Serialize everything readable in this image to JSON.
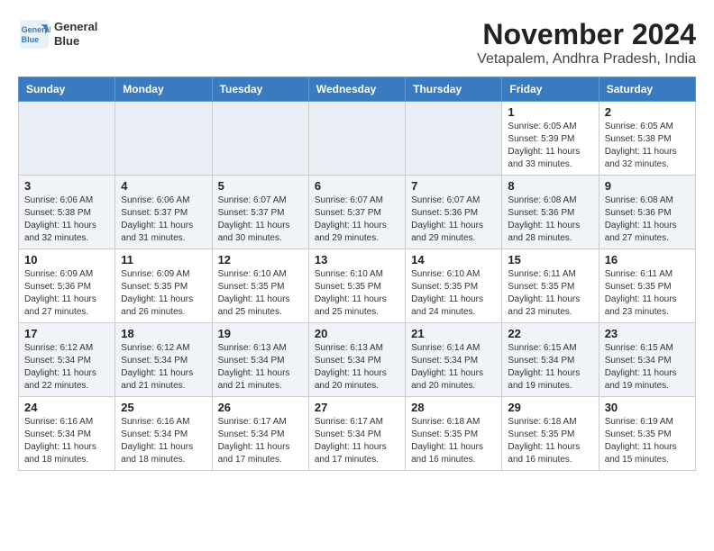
{
  "logo": {
    "line1": "General",
    "line2": "Blue"
  },
  "title": "November 2024",
  "subtitle": "Vetapalem, Andhra Pradesh, India",
  "weekdays": [
    "Sunday",
    "Monday",
    "Tuesday",
    "Wednesday",
    "Thursday",
    "Friday",
    "Saturday"
  ],
  "weeks": [
    [
      {
        "day": "",
        "info": ""
      },
      {
        "day": "",
        "info": ""
      },
      {
        "day": "",
        "info": ""
      },
      {
        "day": "",
        "info": ""
      },
      {
        "day": "",
        "info": ""
      },
      {
        "day": "1",
        "info": "Sunrise: 6:05 AM\nSunset: 5:39 PM\nDaylight: 11 hours\nand 33 minutes."
      },
      {
        "day": "2",
        "info": "Sunrise: 6:05 AM\nSunset: 5:38 PM\nDaylight: 11 hours\nand 32 minutes."
      }
    ],
    [
      {
        "day": "3",
        "info": "Sunrise: 6:06 AM\nSunset: 5:38 PM\nDaylight: 11 hours\nand 32 minutes."
      },
      {
        "day": "4",
        "info": "Sunrise: 6:06 AM\nSunset: 5:37 PM\nDaylight: 11 hours\nand 31 minutes."
      },
      {
        "day": "5",
        "info": "Sunrise: 6:07 AM\nSunset: 5:37 PM\nDaylight: 11 hours\nand 30 minutes."
      },
      {
        "day": "6",
        "info": "Sunrise: 6:07 AM\nSunset: 5:37 PM\nDaylight: 11 hours\nand 29 minutes."
      },
      {
        "day": "7",
        "info": "Sunrise: 6:07 AM\nSunset: 5:36 PM\nDaylight: 11 hours\nand 29 minutes."
      },
      {
        "day": "8",
        "info": "Sunrise: 6:08 AM\nSunset: 5:36 PM\nDaylight: 11 hours\nand 28 minutes."
      },
      {
        "day": "9",
        "info": "Sunrise: 6:08 AM\nSunset: 5:36 PM\nDaylight: 11 hours\nand 27 minutes."
      }
    ],
    [
      {
        "day": "10",
        "info": "Sunrise: 6:09 AM\nSunset: 5:36 PM\nDaylight: 11 hours\nand 27 minutes."
      },
      {
        "day": "11",
        "info": "Sunrise: 6:09 AM\nSunset: 5:35 PM\nDaylight: 11 hours\nand 26 minutes."
      },
      {
        "day": "12",
        "info": "Sunrise: 6:10 AM\nSunset: 5:35 PM\nDaylight: 11 hours\nand 25 minutes."
      },
      {
        "day": "13",
        "info": "Sunrise: 6:10 AM\nSunset: 5:35 PM\nDaylight: 11 hours\nand 25 minutes."
      },
      {
        "day": "14",
        "info": "Sunrise: 6:10 AM\nSunset: 5:35 PM\nDaylight: 11 hours\nand 24 minutes."
      },
      {
        "day": "15",
        "info": "Sunrise: 6:11 AM\nSunset: 5:35 PM\nDaylight: 11 hours\nand 23 minutes."
      },
      {
        "day": "16",
        "info": "Sunrise: 6:11 AM\nSunset: 5:35 PM\nDaylight: 11 hours\nand 23 minutes."
      }
    ],
    [
      {
        "day": "17",
        "info": "Sunrise: 6:12 AM\nSunset: 5:34 PM\nDaylight: 11 hours\nand 22 minutes."
      },
      {
        "day": "18",
        "info": "Sunrise: 6:12 AM\nSunset: 5:34 PM\nDaylight: 11 hours\nand 21 minutes."
      },
      {
        "day": "19",
        "info": "Sunrise: 6:13 AM\nSunset: 5:34 PM\nDaylight: 11 hours\nand 21 minutes."
      },
      {
        "day": "20",
        "info": "Sunrise: 6:13 AM\nSunset: 5:34 PM\nDaylight: 11 hours\nand 20 minutes."
      },
      {
        "day": "21",
        "info": "Sunrise: 6:14 AM\nSunset: 5:34 PM\nDaylight: 11 hours\nand 20 minutes."
      },
      {
        "day": "22",
        "info": "Sunrise: 6:15 AM\nSunset: 5:34 PM\nDaylight: 11 hours\nand 19 minutes."
      },
      {
        "day": "23",
        "info": "Sunrise: 6:15 AM\nSunset: 5:34 PM\nDaylight: 11 hours\nand 19 minutes."
      }
    ],
    [
      {
        "day": "24",
        "info": "Sunrise: 6:16 AM\nSunset: 5:34 PM\nDaylight: 11 hours\nand 18 minutes."
      },
      {
        "day": "25",
        "info": "Sunrise: 6:16 AM\nSunset: 5:34 PM\nDaylight: 11 hours\nand 18 minutes."
      },
      {
        "day": "26",
        "info": "Sunrise: 6:17 AM\nSunset: 5:34 PM\nDaylight: 11 hours\nand 17 minutes."
      },
      {
        "day": "27",
        "info": "Sunrise: 6:17 AM\nSunset: 5:34 PM\nDaylight: 11 hours\nand 17 minutes."
      },
      {
        "day": "28",
        "info": "Sunrise: 6:18 AM\nSunset: 5:35 PM\nDaylight: 11 hours\nand 16 minutes."
      },
      {
        "day": "29",
        "info": "Sunrise: 6:18 AM\nSunset: 5:35 PM\nDaylight: 11 hours\nand 16 minutes."
      },
      {
        "day": "30",
        "info": "Sunrise: 6:19 AM\nSunset: 5:35 PM\nDaylight: 11 hours\nand 15 minutes."
      }
    ]
  ]
}
